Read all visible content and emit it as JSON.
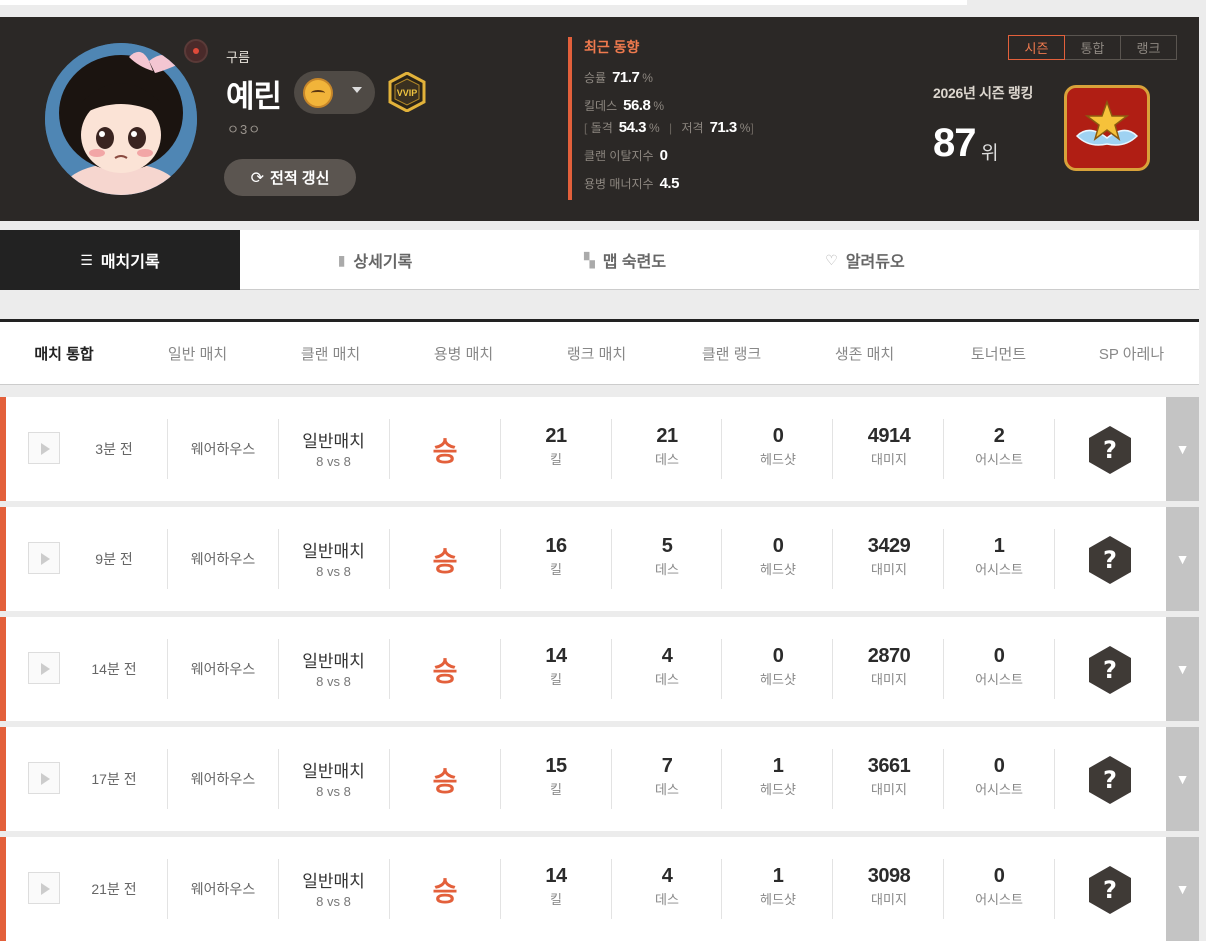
{
  "profile": {
    "clan": "구름",
    "nickname": "예린",
    "subtext": "ㅇ3ㅇ",
    "refresh_label": "전적 갱신"
  },
  "trend": {
    "title": "최근 동향",
    "winrate_label": "승률",
    "winrate_value": "71.7",
    "pct": "%",
    "kd_label": "킬데스",
    "kd_value": "56.8",
    "assault_label": "돌격",
    "assault_value": "54.3",
    "sniper_label": "저격",
    "sniper_value": "71.3",
    "clan_leave_label": "클랜 이탈지수",
    "clan_leave_value": "0",
    "merc_manner_label": "용병 매너지수",
    "merc_manner_value": "4.5"
  },
  "ranking": {
    "tabs": [
      "시즌",
      "통합",
      "랭크"
    ],
    "season_label": "2026년 시즌 랭킹",
    "rank": "87",
    "rank_unit": "위"
  },
  "main_tabs": [
    "매치기록",
    "상세기록",
    "맵 숙련도",
    "알려듀오"
  ],
  "filters": [
    "매치 통합",
    "일반 매치",
    "클랜 매치",
    "용병 매치",
    "랭크 매치",
    "클랜 랭크",
    "생존 매치",
    "토너먼트",
    "SP 아레나"
  ],
  "labels": {
    "kill": "킬",
    "death": "데스",
    "headshot": "헤드샷",
    "damage": "대미지",
    "assist": "어시스트"
  },
  "matches": [
    {
      "time": "3분 전",
      "map": "웨어하우스",
      "mode": "일반매치",
      "format": "8 vs 8",
      "result": "승",
      "kill": "21",
      "death": "21",
      "headshot": "0",
      "damage": "4914",
      "assist": "2"
    },
    {
      "time": "9분 전",
      "map": "웨어하우스",
      "mode": "일반매치",
      "format": "8 vs 8",
      "result": "승",
      "kill": "16",
      "death": "5",
      "headshot": "0",
      "damage": "3429",
      "assist": "1"
    },
    {
      "time": "14분 전",
      "map": "웨어하우스",
      "mode": "일반매치",
      "format": "8 vs 8",
      "result": "승",
      "kill": "14",
      "death": "4",
      "headshot": "0",
      "damage": "2870",
      "assist": "0"
    },
    {
      "time": "17분 전",
      "map": "웨어하우스",
      "mode": "일반매치",
      "format": "8 vs 8",
      "result": "승",
      "kill": "15",
      "death": "7",
      "headshot": "1",
      "damage": "3661",
      "assist": "0"
    },
    {
      "time": "21분 전",
      "map": "웨어하우스",
      "mode": "일반매치",
      "format": "8 vs 8",
      "result": "승",
      "kill": "14",
      "death": "4",
      "headshot": "1",
      "damage": "3098",
      "assist": "0"
    }
  ],
  "colors": {
    "accent": "#e3603b",
    "header_bg": "#2b2826",
    "win": "#e3603b"
  },
  "icons": {
    "play": "play-icon",
    "expand": "triangle-down-icon",
    "refresh": "refresh-icon",
    "unknown_badge": "question-badge-icon"
  }
}
